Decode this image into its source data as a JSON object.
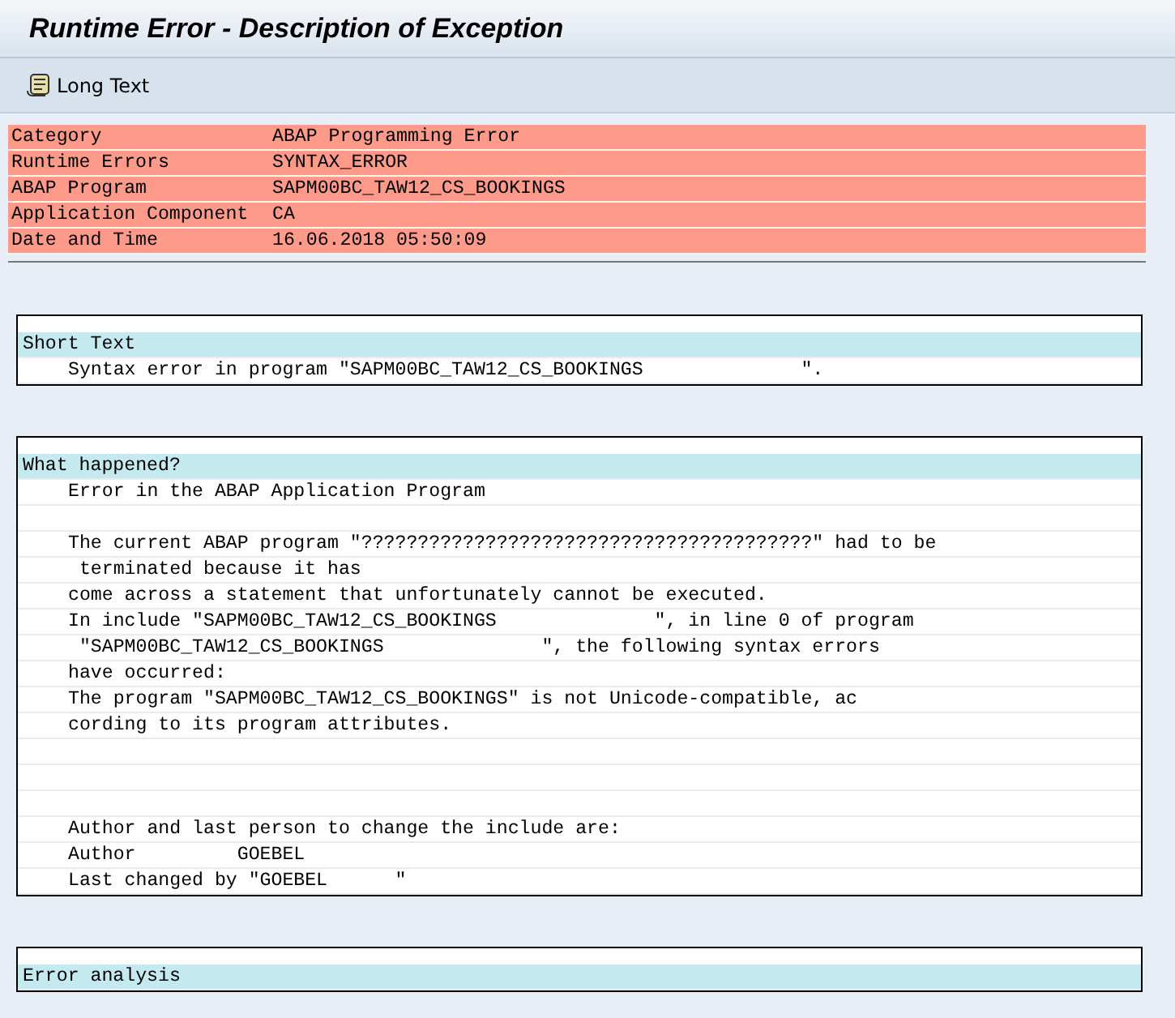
{
  "window": {
    "title": "Runtime Error - Description of Exception"
  },
  "toolbar": {
    "buttons": [
      {
        "label": "Long Text"
      }
    ]
  },
  "summary": [
    {
      "label": "Category",
      "value": "ABAP Programming Error"
    },
    {
      "label": "Runtime Errors",
      "value": "SYNTAX_ERROR"
    },
    {
      "label": "ABAP Program",
      "value": "SAPM00BC_TAW12_CS_BOOKINGS"
    },
    {
      "label": "Application Component",
      "value": "CA"
    },
    {
      "label": "Date and Time",
      "value": "16.06.2018 05:50:09"
    }
  ],
  "sections": [
    {
      "heading": "Short Text",
      "lines": [
        {
          "kind": "text",
          "text": "Syntax error in program \"SAPM00BC_TAW12_CS_BOOKINGS              \"."
        }
      ]
    },
    {
      "heading": "What happened?",
      "lines": [
        {
          "kind": "text",
          "text": "Error in the ABAP Application Program"
        },
        {
          "kind": "blank"
        },
        {
          "kind": "text",
          "text": "The current ABAP program \"????????????????????????????????????????\" had to be"
        },
        {
          "kind": "text",
          "text": " terminated because it has"
        },
        {
          "kind": "text",
          "text": "come across a statement that unfortunately cannot be executed."
        },
        {
          "kind": "text",
          "text": "In include \"SAPM00BC_TAW12_CS_BOOKINGS              \", in line 0 of program"
        },
        {
          "kind": "text",
          "text": " \"SAPM00BC_TAW12_CS_BOOKINGS              \", the following syntax errors"
        },
        {
          "kind": "text",
          "text": "have occurred:"
        },
        {
          "kind": "text",
          "text": "The program \"SAPM00BC_TAW12_CS_BOOKINGS\" is not Unicode-compatible, ac"
        },
        {
          "kind": "text",
          "text": "cording to its program attributes."
        },
        {
          "kind": "blank"
        },
        {
          "kind": "blank"
        },
        {
          "kind": "blank"
        },
        {
          "kind": "text",
          "text": "Author and last person to change the include are:"
        },
        {
          "kind": "text",
          "text": "Author         GOEBEL"
        },
        {
          "kind": "text",
          "text": "Last changed by \"GOEBEL      \""
        }
      ]
    },
    {
      "heading": "Error analysis"
    }
  ]
}
